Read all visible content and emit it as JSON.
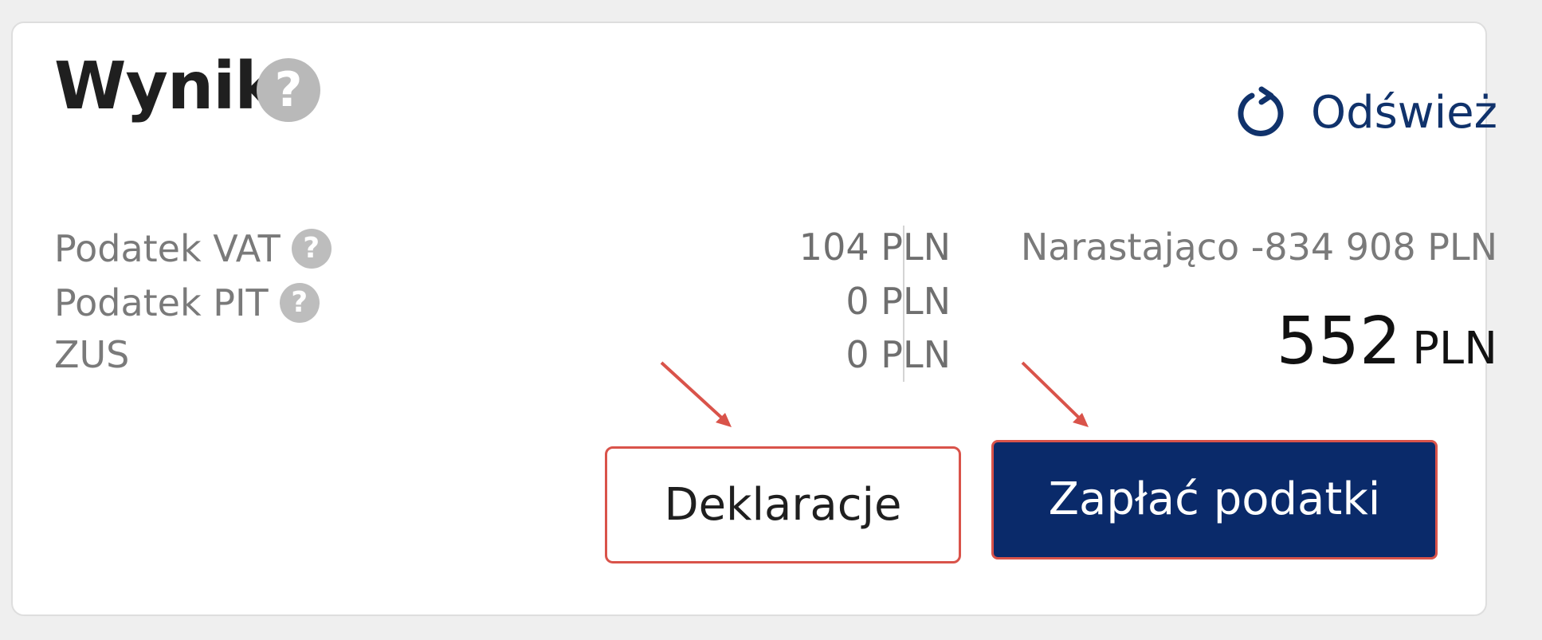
{
  "card": {
    "title": "Wynik",
    "help_glyph": "?",
    "refresh_label": "Odśwież"
  },
  "taxes": [
    {
      "label": "Podatek VAT",
      "amount": "104 PLN",
      "has_help": true
    },
    {
      "label": "Podatek PIT",
      "amount": "0 PLN",
      "has_help": true
    },
    {
      "label": "ZUS",
      "amount": "0 PLN",
      "has_help": false
    }
  ],
  "summary": {
    "cumulative": "Narastająco -834 908 PLN",
    "total_value": "552",
    "total_currency": "PLN"
  },
  "buttons": {
    "declarations": "Deklaracje",
    "pay": "Zapłać podatki"
  },
  "colors": {
    "primary": "#0a2a6a",
    "link": "#10326b",
    "annotation": "#d9534a",
    "help_icon": "#b9b9b9"
  },
  "icons": {
    "refresh": "refresh-icon",
    "help": "question-mark-icon"
  }
}
